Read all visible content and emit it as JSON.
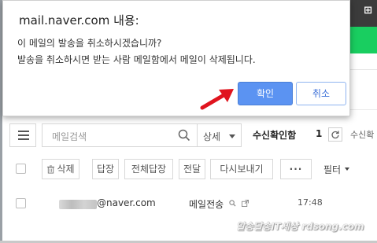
{
  "dialog": {
    "title": "mail.naver.com 내용:",
    "message_line1": "이 메일의 발송을 취소하시겠습니까?",
    "message_line2": "발송을 취소하시면 받는 사람 메일함에서 메일이 삭제됩니다.",
    "confirm_label": "확인",
    "cancel_label": "취소"
  },
  "search": {
    "placeholder": "메일검색",
    "detail_label": "상세"
  },
  "header": {
    "read_receipt_label": "수신확인함",
    "count": "1",
    "received_label_partial": "수신확"
  },
  "toolbar": {
    "delete_label": "삭제",
    "reply_label": "답장",
    "reply_all_label": "전체답장",
    "forward_label": "전달",
    "resend_label": "다시보내기",
    "more_label": "···",
    "filter_label": "필터"
  },
  "mail_list": [
    {
      "sender_suffix": "@naver.com",
      "subject": "메일전송",
      "time": "17:48"
    }
  ],
  "watermark": "알송달송IT세상 rdsong.com",
  "colors": {
    "confirm_button": "#5b93f2",
    "cancel_button_text": "#3a6fd8",
    "naver_green": "#19ce60",
    "arrow_red": "#e0141e"
  }
}
